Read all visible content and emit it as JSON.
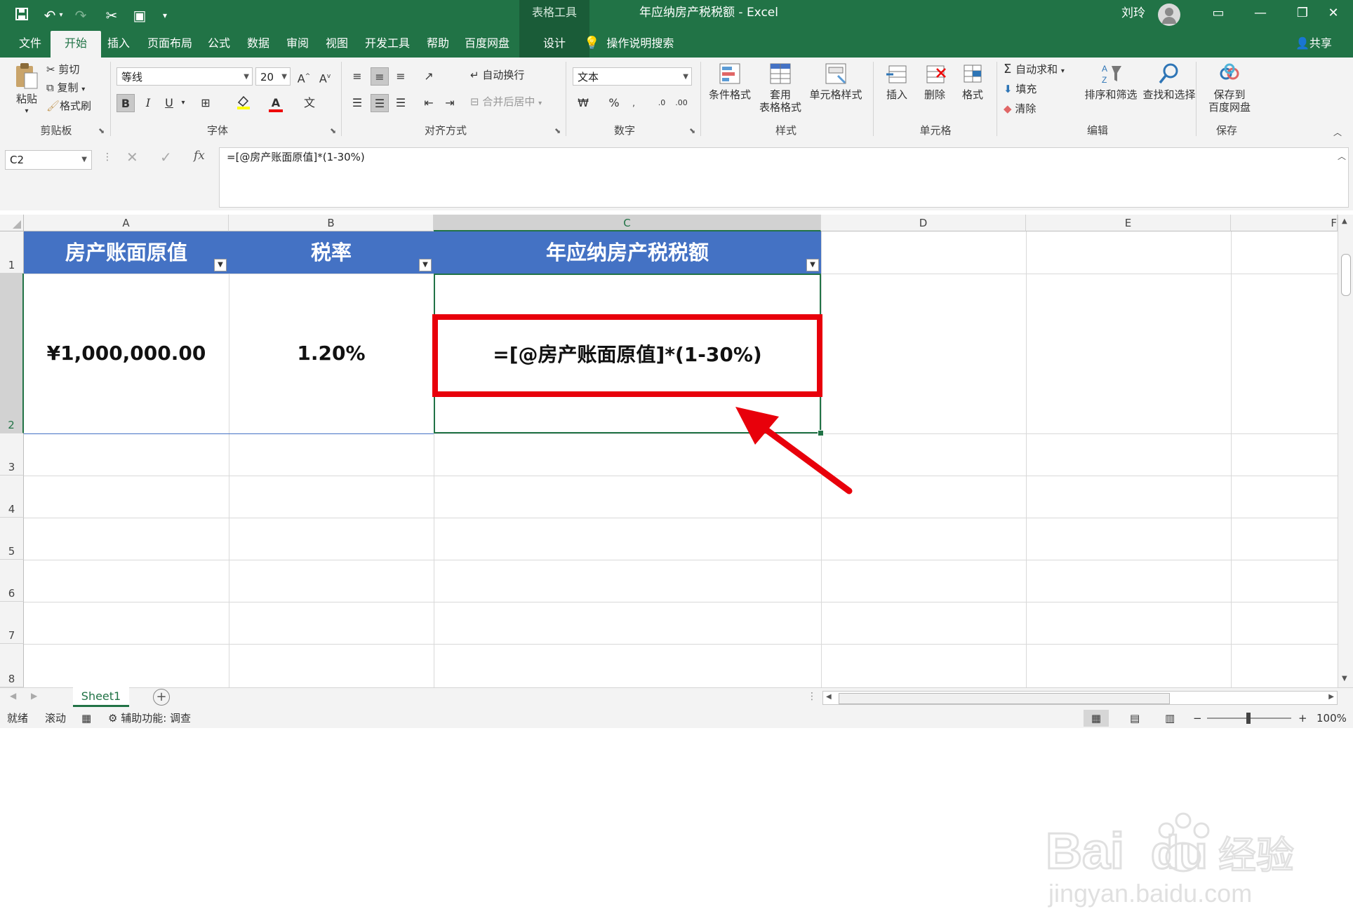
{
  "window": {
    "title": "年应纳房产税税额 - Excel",
    "contextual_tab_group": "表格工具",
    "user_name": "刘玲"
  },
  "tabs": [
    {
      "label": "文件"
    },
    {
      "label": "开始"
    },
    {
      "label": "插入"
    },
    {
      "label": "页面布局"
    },
    {
      "label": "公式"
    },
    {
      "label": "数据"
    },
    {
      "label": "审阅"
    },
    {
      "label": "视图"
    },
    {
      "label": "开发工具"
    },
    {
      "label": "帮助"
    },
    {
      "label": "百度网盘"
    },
    {
      "label": "设计"
    }
  ],
  "tell_me": "操作说明搜索",
  "share": "共享",
  "ribbon": {
    "clipboard": {
      "label": "剪贴板",
      "paste": "粘贴",
      "cut": "剪切",
      "copy": "复制",
      "format_painter": "格式刷"
    },
    "font": {
      "label": "字体",
      "name": "等线",
      "size": "20",
      "bold": "B",
      "italic": "I",
      "underline": "U"
    },
    "alignment": {
      "label": "对齐方式",
      "wrap": "自动换行",
      "merge": "合并后居中"
    },
    "number": {
      "label": "数字",
      "format": "文本",
      "percent": "%"
    },
    "styles": {
      "label": "样式",
      "conditional": "条件格式",
      "table_fmt_1": "套用",
      "table_fmt_2": "表格格式",
      "cell_styles": "单元格样式"
    },
    "cells": {
      "label": "单元格",
      "insert": "插入",
      "delete": "删除",
      "format": "格式"
    },
    "editing": {
      "label": "编辑",
      "autosum": "自动求和",
      "fill": "填充",
      "clear": "清除",
      "sort_filter": "排序和筛选",
      "find_select": "查找和选择"
    },
    "save": {
      "label": "保存",
      "save_to_1": "保存到",
      "save_to_2": "百度网盘"
    }
  },
  "formula_bar": {
    "name_box": "C2",
    "formula": "=[@房产账面原值]*(1-30%)",
    "fx": "fx"
  },
  "sheet": {
    "columns": [
      "A",
      "B",
      "C",
      "D",
      "E",
      "F"
    ],
    "rows": [
      "1",
      "2",
      "3",
      "4",
      "5",
      "6",
      "7",
      "8"
    ],
    "headers": [
      "房产账面原值",
      "税率",
      "年应纳房产税税额"
    ],
    "row2": [
      "¥1,000,000.00",
      "1.20%",
      "=[@房产账面原值]*(1-30%)"
    ],
    "selected_cell": "C2"
  },
  "sheet_tabs": [
    "Sheet1"
  ],
  "status": {
    "mode": "就绪",
    "scroll": "滚动",
    "accessibility": "辅助功能: 调查",
    "zoom": "100%"
  },
  "watermark": {
    "brand": "Bai",
    "brand_cn": "经验",
    "url": "jingyan.baidu.com"
  },
  "colors": {
    "excel_green": "#217346",
    "table_header_blue": "#4472c4",
    "highlight_red": "#e8000b"
  }
}
